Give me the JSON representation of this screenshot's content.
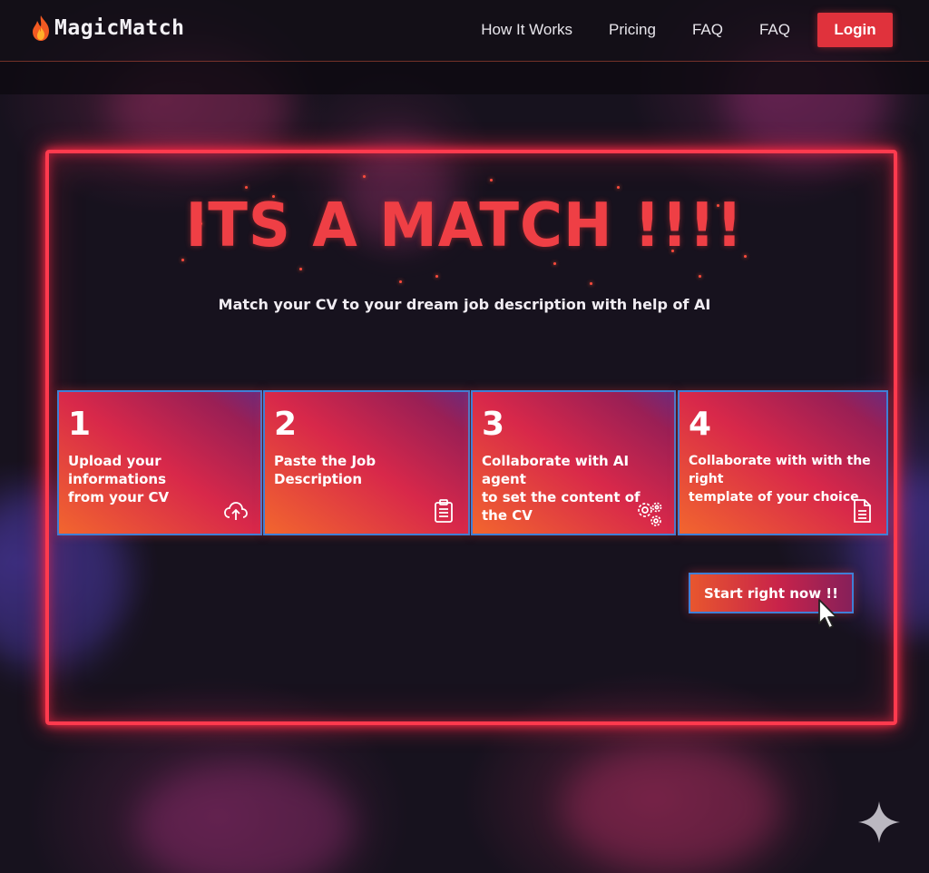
{
  "header": {
    "brand": "MagicMatch",
    "nav": [
      "How It Works",
      "Pricing",
      "FAQ",
      "FAQ"
    ],
    "login_label": "Login"
  },
  "hero": {
    "title": "ITS A MATCH !!!!",
    "subtitle": "Match your CV to your dream job description with help of AI"
  },
  "steps": [
    {
      "number": "1",
      "text": "Upload your informations\nfrom your CV",
      "icon": "cloud-upload-icon"
    },
    {
      "number": "2",
      "text": "Paste the Job Description",
      "icon": "clipboard-icon"
    },
    {
      "number": "3",
      "text": "Collaborate with AI agent\nto set the content of the CV",
      "icon": "gears-icon"
    },
    {
      "number": "4",
      "text": "Collaborate with with the right\ntemplate of your choice",
      "icon": "document-icon"
    }
  ],
  "cta": {
    "label": "Start right now !!"
  },
  "colors": {
    "accent": "#e0323c",
    "neon": "#ff3a4e",
    "card_border": "#3f7fd6",
    "title_red": "#ef3f45"
  }
}
